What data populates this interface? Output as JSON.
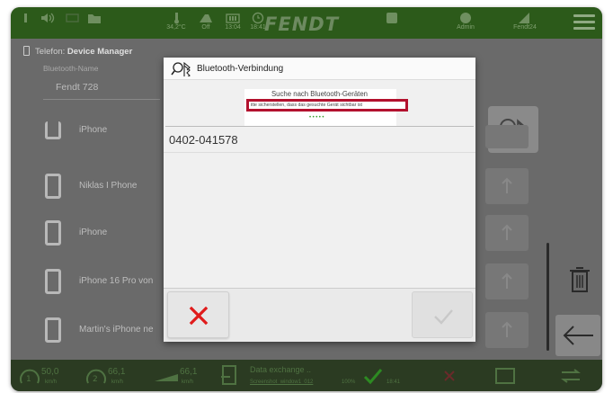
{
  "topbar": {
    "speed_a": "34,2°C",
    "off_label": "Off",
    "time_a": "13:04",
    "time_b": "18:41",
    "brand": "FENDT",
    "admin_label": "Admin",
    "fendt24_label": "Fendt24"
  },
  "page": {
    "header_prefix": "Telefon:",
    "header_title": "Device Manager",
    "bt_name_label": "Bluetooth-Name",
    "bt_name_value": "Fendt 728",
    "devices": [
      {
        "label": "iPhone"
      },
      {
        "label": "Niklas I Phone"
      },
      {
        "label": "iPhone"
      },
      {
        "label": "iPhone 16 Pro von"
      },
      {
        "label": "Martin's iPhone ne"
      }
    ]
  },
  "statusbar": {
    "speed1": "50,0",
    "speed1_unit": "km/h",
    "speed2": "66,1",
    "speed2_unit": "km/h",
    "speed3": "66,1",
    "speed3_unit": "km/h",
    "data_exchange": "Data exchange ..",
    "data_sub": "Screenshot_window1_012",
    "percent": "100%",
    "time": "18:41"
  },
  "dialog": {
    "title": "Bluetooth-Verbindung",
    "search_text": "Suche nach Bluetooth-Geräten",
    "hint_text": "itte sicherstellen, dass das gesuchte Gerät sichtbar ist",
    "progress_dots": "•••••",
    "items": [
      {
        "label": "0402-041578"
      }
    ],
    "cancel_label": "✕",
    "ok_label": "✓"
  }
}
